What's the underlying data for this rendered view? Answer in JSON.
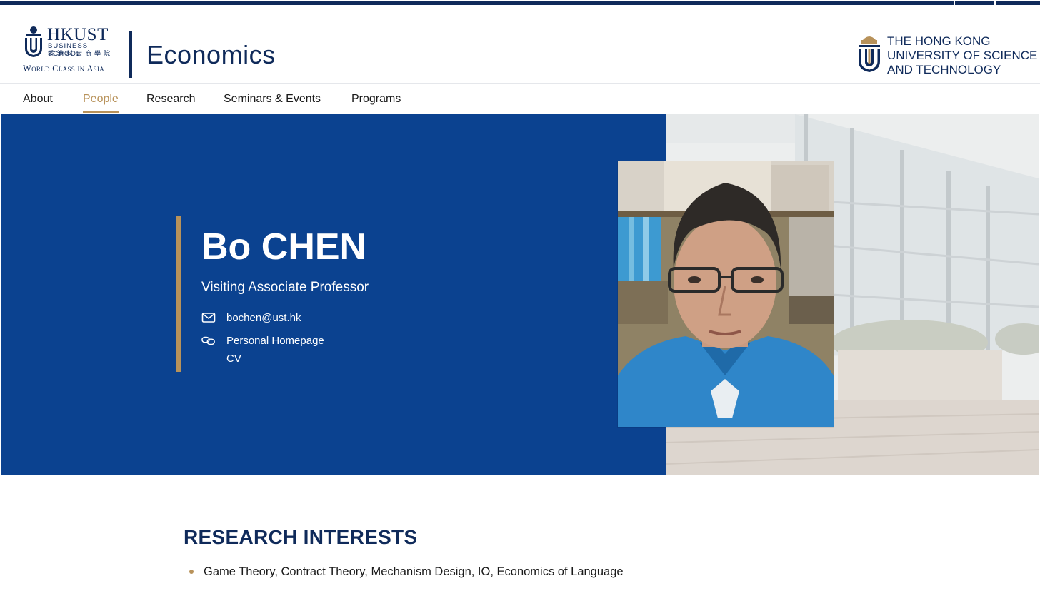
{
  "brand": {
    "school_name": "HKUST",
    "school_sub": "BUSINESS SCHOOL",
    "school_cn": "香港科大商學院",
    "tagline": "World Class in Asia",
    "department": "Economics",
    "university_lines": [
      "The Hong Kong",
      "University of Science",
      "and Technology"
    ]
  },
  "nav": {
    "items": [
      {
        "label": "About",
        "active": false
      },
      {
        "label": "People",
        "active": true
      },
      {
        "label": "Research",
        "active": false
      },
      {
        "label": "Seminars & Events",
        "active": false
      },
      {
        "label": "Programs",
        "active": false
      }
    ]
  },
  "profile": {
    "name": "Bo CHEN",
    "title": "Visiting Associate Professor",
    "email": "bochen@ust.hk",
    "homepage_label": "Personal Homepage",
    "cv_label": "CV",
    "icons": {
      "email": "envelope-icon",
      "homepage": "link-icon"
    }
  },
  "research": {
    "heading": "RESEARCH INTERESTS",
    "items": [
      "Game Theory, Contract Theory, Mechanism Design, IO, Economics of Language"
    ]
  },
  "colors": {
    "navy": "#0f2a5a",
    "hero_blue": "#0b4290",
    "gold": "#b8925a",
    "nav_text": "#1a1a1a"
  }
}
